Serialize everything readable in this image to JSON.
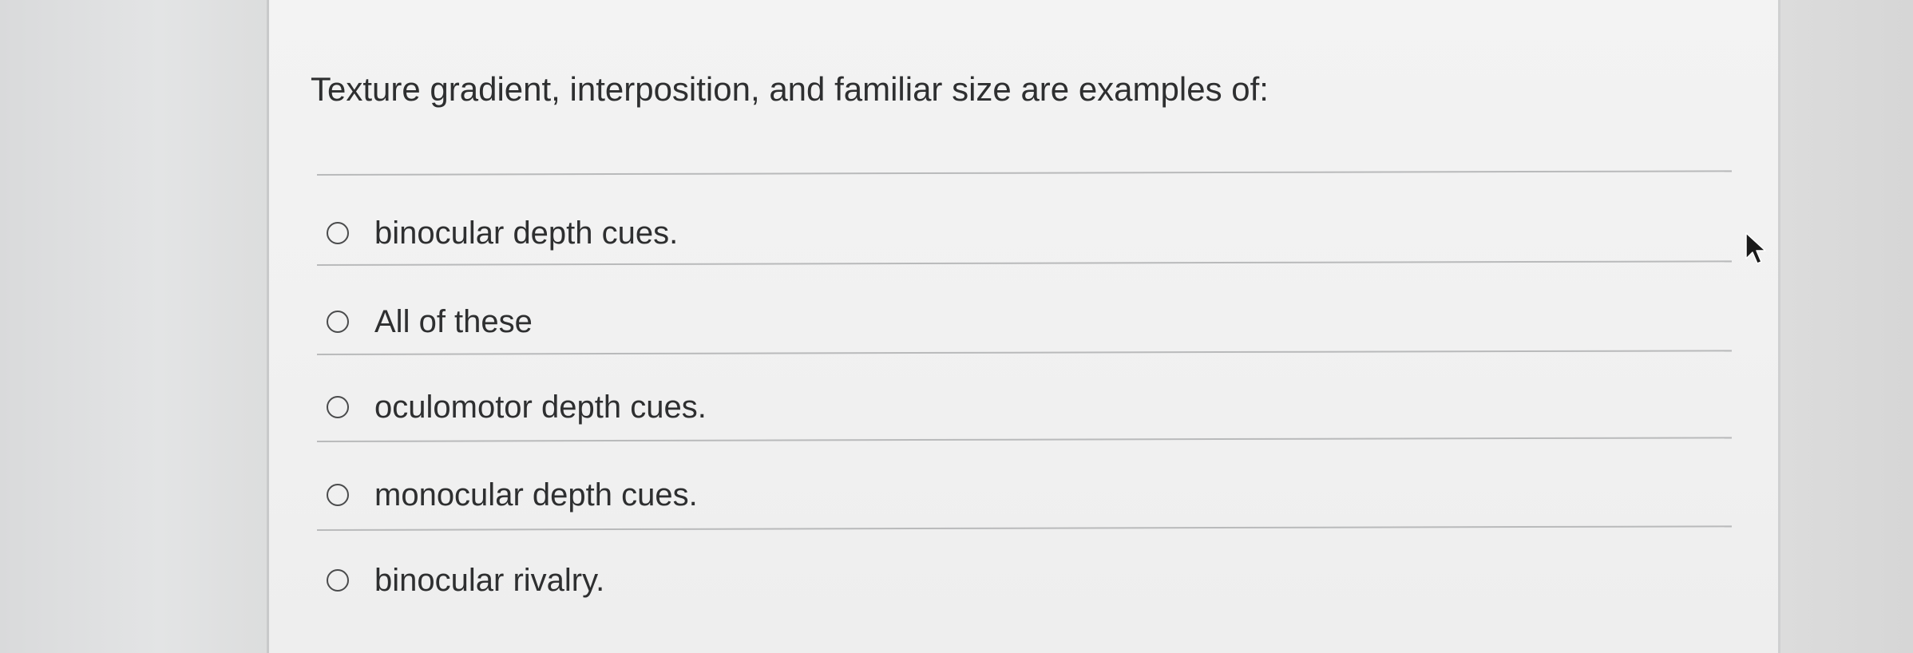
{
  "question": {
    "text": "Texture gradient, interposition, and familiar size are examples of:"
  },
  "options": [
    {
      "label": "binocular depth cues.",
      "selected": false
    },
    {
      "label": "All of these",
      "selected": false
    },
    {
      "label": "oculomotor depth cues.",
      "selected": false
    },
    {
      "label": "monocular depth cues.",
      "selected": false
    },
    {
      "label": "binocular rivalry.",
      "selected": false
    }
  ],
  "icons": {
    "radio": "radio-button-icon",
    "cursor": "mouse-pointer-icon"
  },
  "colors": {
    "text": "#2e2f30",
    "card_background": "#f1f1f1",
    "divider": "#b9babb",
    "radio_border": "#4a4b4c"
  }
}
